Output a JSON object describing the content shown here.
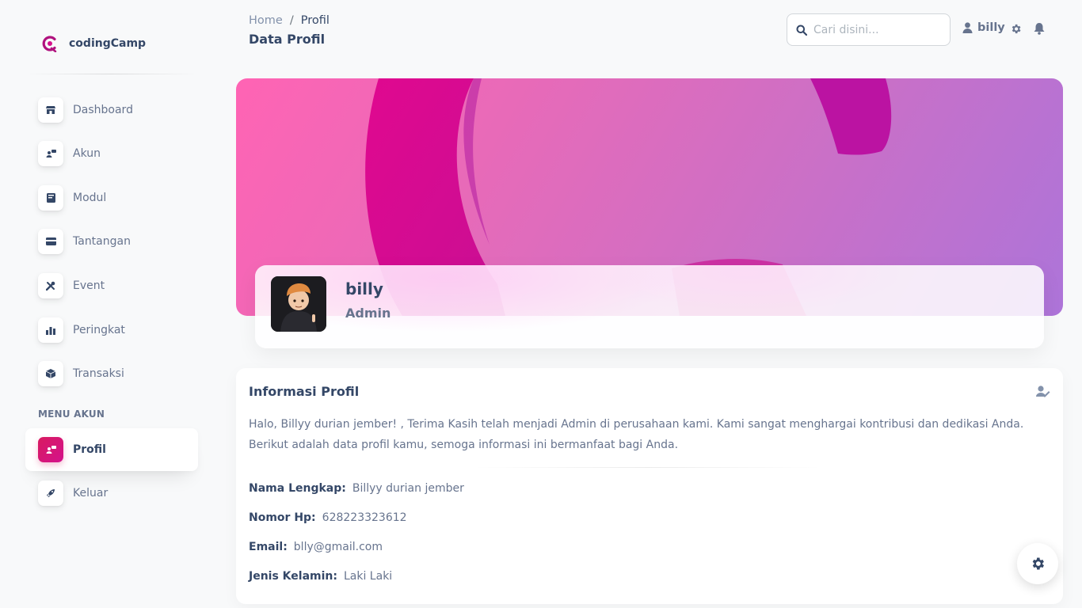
{
  "brand": {
    "name": "codingCamp"
  },
  "sidebar": {
    "items": [
      {
        "label": "Dashboard",
        "icon": "shop-icon"
      },
      {
        "label": "Akun",
        "icon": "user-card-icon"
      },
      {
        "label": "Modul",
        "icon": "book-icon"
      },
      {
        "label": "Tantangan",
        "icon": "credit-card-icon"
      },
      {
        "label": "Event",
        "icon": "tools-icon"
      },
      {
        "label": "Peringkat",
        "icon": "chart-icon"
      },
      {
        "label": "Transaksi",
        "icon": "box-icon"
      }
    ],
    "section_label": "MENU AKUN",
    "account_items": [
      {
        "label": "Profil",
        "icon": "user-card-icon",
        "active": true
      },
      {
        "label": "Keluar",
        "icon": "rocket-icon"
      }
    ]
  },
  "header": {
    "breadcrumb": {
      "home": "Home",
      "separator": "/",
      "current": "Profil"
    },
    "title": "Data Profil",
    "search_placeholder": "Cari disini...",
    "user": "billy"
  },
  "profile": {
    "name": "billy",
    "role": "Admin"
  },
  "info": {
    "title": "Informasi Profil",
    "text": "Halo, Billyy durian jember! , Terima Kasih telah menjadi Admin di perusahaan kami. Kami sangat menghargai kontribusi dan dedikasi Anda. Berikut adalah data profil kamu, semoga informasi ini bermanfaat bagi Anda.",
    "fields": [
      {
        "key": "Nama Lengkap:",
        "value": "Billyy durian jember"
      },
      {
        "key": "Nomor Hp:",
        "value": "628223323612"
      },
      {
        "key": "Email:",
        "value": "blly@gmail.com"
      },
      {
        "key": "Jenis Kelamin:",
        "value": "Laki Laki"
      }
    ]
  },
  "colors": {
    "accent": "#d4128c",
    "text": "#344767",
    "muted": "#67748e"
  }
}
